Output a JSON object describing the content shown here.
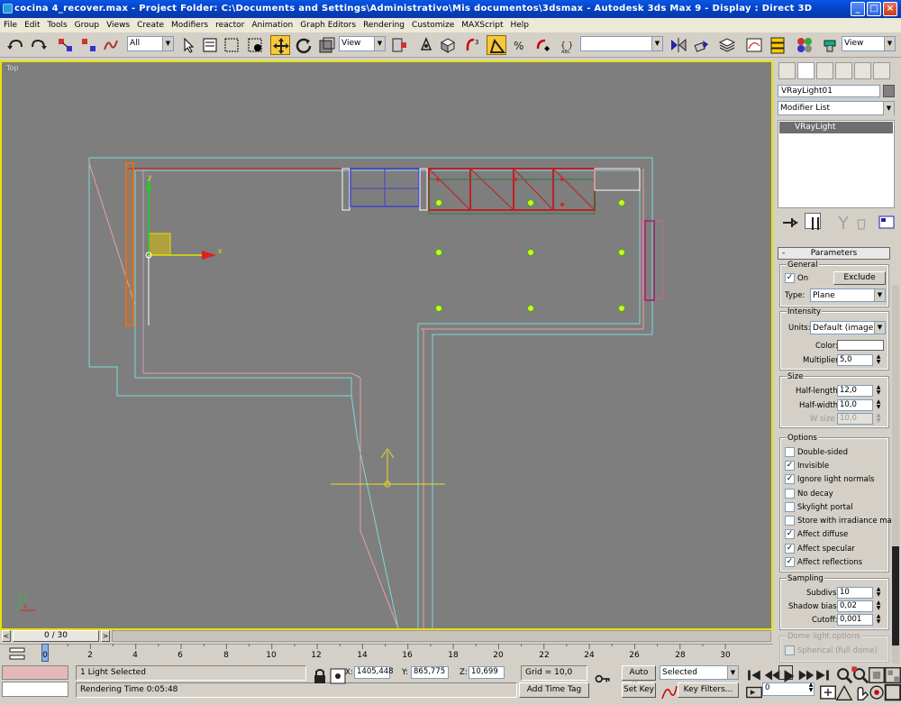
{
  "window": {
    "title": "cocina 4_recover.max    - Project Folder: C:\\Documents and Settings\\Administrativo\\Mis documentos\\3dsmax    - Autodesk 3ds Max 9    - Display : Direct 3D",
    "controls": {
      "minimize": "_",
      "maximize": "□",
      "close": "×"
    }
  },
  "menu": [
    "File",
    "Edit",
    "Tools",
    "Group",
    "Views",
    "Create",
    "Modifiers",
    "reactor",
    "Animation",
    "Graph Editors",
    "Rendering",
    "Customize",
    "MAXScript",
    "Help"
  ],
  "toolbar": {
    "selection_filter": "All",
    "reference_coord": "View",
    "named_selection": "",
    "render_view": "View"
  },
  "viewport": {
    "label": "Top",
    "gizmo_axes": {
      "x": "x",
      "y": "y"
    }
  },
  "command_panel": {
    "object_name": "VRayLight01",
    "object_color": "#808080",
    "modifier_list": "Modifier List",
    "stack_items": [
      "VRayLight"
    ],
    "rollout_title": "Parameters",
    "general": {
      "label": "General",
      "on_label": "On",
      "on_checked": true,
      "exclude_label": "Exclude",
      "type_label": "Type:",
      "type_value": "Plane"
    },
    "intensity": {
      "label": "Intensity",
      "units_label": "Units:",
      "units_value": "Default (image)",
      "color_label": "Color:",
      "color_value": "#ffffff",
      "multiplier_label": "Multiplier:",
      "multiplier_value": "5,0"
    },
    "size": {
      "label": "Size",
      "half_length_label": "Half-length:",
      "half_length_value": "12,0",
      "half_width_label": "Half-width:",
      "half_width_value": "10,0",
      "w_size_label": "W size",
      "w_size_value": "10,0"
    },
    "options": {
      "label": "Options",
      "items": [
        {
          "label": "Double-sided",
          "checked": false
        },
        {
          "label": "Invisible",
          "checked": true
        },
        {
          "label": "Ignore light normals",
          "checked": true
        },
        {
          "label": "No decay",
          "checked": false
        },
        {
          "label": "Skylight portal",
          "checked": false
        },
        {
          "label": "Store with irradiance map",
          "checked": false
        },
        {
          "label": "Affect diffuse",
          "checked": true
        },
        {
          "label": "Affect specular",
          "checked": true
        },
        {
          "label": "Affect reflections",
          "checked": true
        }
      ]
    },
    "sampling": {
      "label": "Sampling",
      "subdivs_label": "Subdivs:",
      "subdivs_value": "10",
      "shadow_bias_label": "Shadow bias:",
      "shadow_bias_value": "0,02",
      "cutoff_label": "Cutoff:",
      "cutoff_value": "0,001"
    },
    "dome": {
      "label": "Dome light options",
      "spherical_label": "Spherical (full dome)",
      "spherical_checked": false
    }
  },
  "timeline": {
    "frame_display": "0 / 30",
    "prev": "<",
    "next": ">",
    "ticks": [
      "0",
      "2",
      "4",
      "6",
      "8",
      "10",
      "12",
      "14",
      "16",
      "18",
      "20",
      "22",
      "24",
      "26",
      "28",
      "30"
    ]
  },
  "status": {
    "selection": "1 Light Selected",
    "render_time": "Rendering Time  0:05:48",
    "x_label": "X:",
    "x_value": "1405,448",
    "y_label": "Y:",
    "y_value": "865,775",
    "z_label": "Z:",
    "z_value": "10,699",
    "grid": "Grid = 10,0",
    "add_time_tag": "Add Time Tag",
    "auto_key": "Auto Key",
    "set_key": "Set Key",
    "key_mode": "Selected",
    "key_filters": "Key Filters...",
    "current_frame": "0"
  }
}
